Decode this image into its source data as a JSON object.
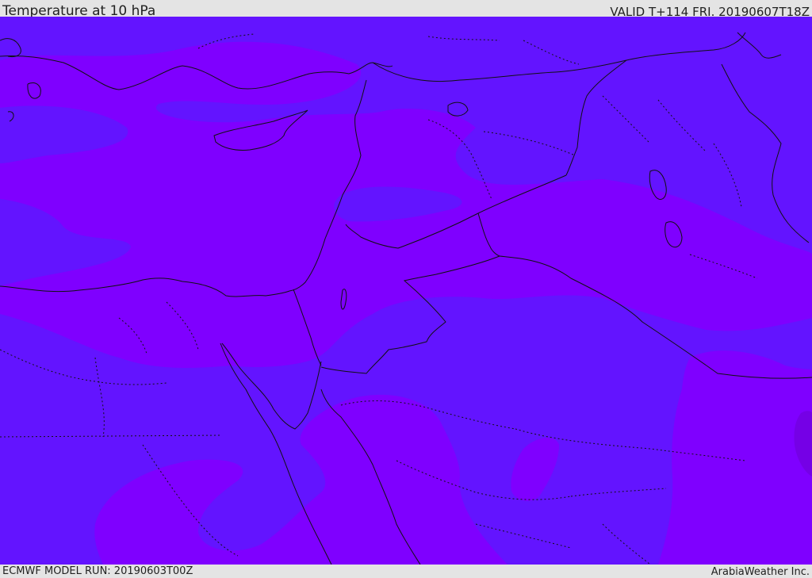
{
  "header": {
    "title": "Temperature at 10 hPa",
    "valid": "VALID T+114 FRI. 20190607T18Z"
  },
  "footer": {
    "model_run": "ECMWF MODEL RUN: 20190603T00Z",
    "credit": "ArabiaWeather Inc."
  },
  "colors": {
    "band_cool": "#6314ff",
    "band_warm": "#7f00ff",
    "band_warmest": "#7500e6",
    "coastline": "#111111",
    "border": "#111111",
    "frame": "#e4e4e4"
  }
}
